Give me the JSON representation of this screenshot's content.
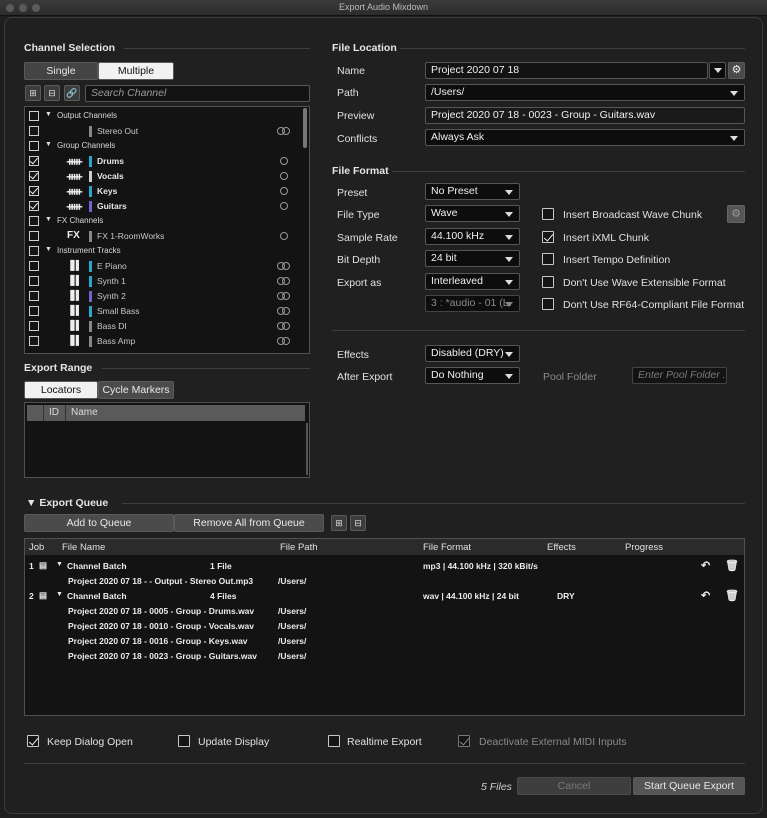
{
  "window": {
    "title": "Export Audio Mixdown"
  },
  "channel_selection": {
    "title": "Channel Selection",
    "mode_single": "Single",
    "mode_multiple": "Multiple",
    "search_placeholder": "Search Channel",
    "tree": [
      {
        "type": "group",
        "label": "Output Channels",
        "checked": false
      },
      {
        "type": "channel",
        "icon": "",
        "name": "Stereo Out",
        "color": "#888888",
        "checked": false,
        "bold": false,
        "pan": "stereo"
      },
      {
        "type": "group",
        "label": "Group Channels",
        "checked": false
      },
      {
        "type": "channel",
        "icon": "group-icon",
        "name": "Drums",
        "color": "#2aa7c9",
        "checked": true,
        "bold": true,
        "pan": "mono"
      },
      {
        "type": "channel",
        "icon": "group-icon",
        "name": "Vocals",
        "color": "#cccccc",
        "checked": true,
        "bold": true,
        "pan": "mono"
      },
      {
        "type": "channel",
        "icon": "group-icon",
        "name": "Keys",
        "color": "#2aa7c9",
        "checked": true,
        "bold": true,
        "pan": "mono"
      },
      {
        "type": "channel",
        "icon": "group-icon",
        "name": "Guitars",
        "color": "#7a5fd0",
        "checked": true,
        "bold": true,
        "pan": "mono"
      },
      {
        "type": "group",
        "label": "FX Channels",
        "checked": false
      },
      {
        "type": "channel",
        "icon": "fx-icon",
        "name": "FX 1-RoomWorks",
        "color": "#888888",
        "checked": false,
        "bold": false,
        "pan": "mono"
      },
      {
        "type": "group",
        "label": "Instrument Tracks",
        "checked": false
      },
      {
        "type": "channel",
        "icon": "piano-icon",
        "name": "E Piano",
        "color": "#2aa7c9",
        "checked": false,
        "bold": false,
        "pan": "stereo"
      },
      {
        "type": "channel",
        "icon": "piano-icon",
        "name": "Synth 1",
        "color": "#2aa7c9",
        "checked": false,
        "bold": false,
        "pan": "stereo"
      },
      {
        "type": "channel",
        "icon": "piano-icon",
        "name": "Synth 2",
        "color": "#7a5fd0",
        "checked": false,
        "bold": false,
        "pan": "stereo"
      },
      {
        "type": "channel",
        "icon": "piano-icon",
        "name": "Small Bass",
        "color": "#2aa7c9",
        "checked": false,
        "bold": false,
        "pan": "stereo"
      },
      {
        "type": "channel",
        "icon": "piano-icon",
        "name": "Bass DI",
        "color": "#888888",
        "checked": false,
        "bold": false,
        "pan": "stereo"
      },
      {
        "type": "channel",
        "icon": "piano-icon",
        "name": "Bass Amp",
        "color": "#888888",
        "checked": false,
        "bold": false,
        "pan": "stereo"
      }
    ]
  },
  "export_range": {
    "title": "Export Range",
    "tab_locators": "Locators",
    "tab_cycle": "Cycle Markers",
    "col_id": "ID",
    "col_name": "Name"
  },
  "file_location": {
    "title": "File Location",
    "name_label": "Name",
    "name_value": "Project 2020 07 18",
    "path_label": "Path",
    "path_value": "/Users/",
    "preview_label": "Preview",
    "preview_value": "Project 2020 07 18 - 0023 - Group - Guitars.wav",
    "conflicts_label": "Conflicts",
    "conflicts_value": "Always Ask"
  },
  "file_format": {
    "title": "File Format",
    "preset_label": "Preset",
    "preset_value": "No Preset",
    "filetype_label": "File Type",
    "filetype_value": "Wave",
    "samplerate_label": "Sample Rate",
    "samplerate_value": "44.100 kHz",
    "bitdepth_label": "Bit Depth",
    "bitdepth_value": "24 bit",
    "exportas_label": "Export as",
    "exportas_value": "Interleaved",
    "channel_value": "3 : *audio - 01 (L.",
    "opt_bwf": "Insert Broadcast Wave Chunk",
    "opt_ixml": "Insert iXML Chunk",
    "opt_tempo": "Insert Tempo Definition",
    "opt_wavext": "Don't Use Wave Extensible Format",
    "opt_rf64": "Don't Use RF64-Compliant File Format"
  },
  "effects": {
    "effects_label": "Effects",
    "effects_value": "Disabled (DRY)",
    "after_label": "After Export",
    "after_value": "Do Nothing",
    "pool_label": "Pool Folder",
    "pool_placeholder": "Enter Pool Folder ."
  },
  "queue": {
    "title": "Export Queue",
    "add_btn": "Add to Queue",
    "remove_btn": "Remove All from Queue",
    "col_job": "Job",
    "col_file": "File Name",
    "col_path": "File Path",
    "col_format": "File Format",
    "col_effects": "Effects",
    "col_progress": "Progress",
    "jobs": [
      {
        "num": "1",
        "name": "Channel Batch",
        "count": "1 File",
        "format": "mp3 | 44.100 kHz | 320 kBit/s",
        "effects": "",
        "files": [
          {
            "name": "Project 2020 07 18 -  - Output - Stereo Out.mp3",
            "path": "/Users/"
          }
        ]
      },
      {
        "num": "2",
        "name": "Channel Batch",
        "count": "4 Files",
        "format": "wav | 44.100 kHz | 24 bit",
        "effects": "DRY",
        "files": [
          {
            "name": "Project 2020 07 18 - 0005 - Group - Drums.wav",
            "path": "/Users/"
          },
          {
            "name": "Project 2020 07 18 - 0010 - Group - Vocals.wav",
            "path": "/Users/"
          },
          {
            "name": "Project 2020 07 18 - 0016 - Group - Keys.wav",
            "path": "/Users/"
          },
          {
            "name": "Project 2020 07 18 - 0023 - Group - Guitars.wav",
            "path": "/Users/"
          }
        ]
      }
    ]
  },
  "bottom": {
    "keep_open": "Keep Dialog Open",
    "update_display": "Update Display",
    "realtime": "Realtime Export",
    "deactivate_midi": "Deactivate External MIDI Inputs",
    "file_count": "5 Files",
    "cancel": "Cancel",
    "start": "Start Queue Export"
  }
}
